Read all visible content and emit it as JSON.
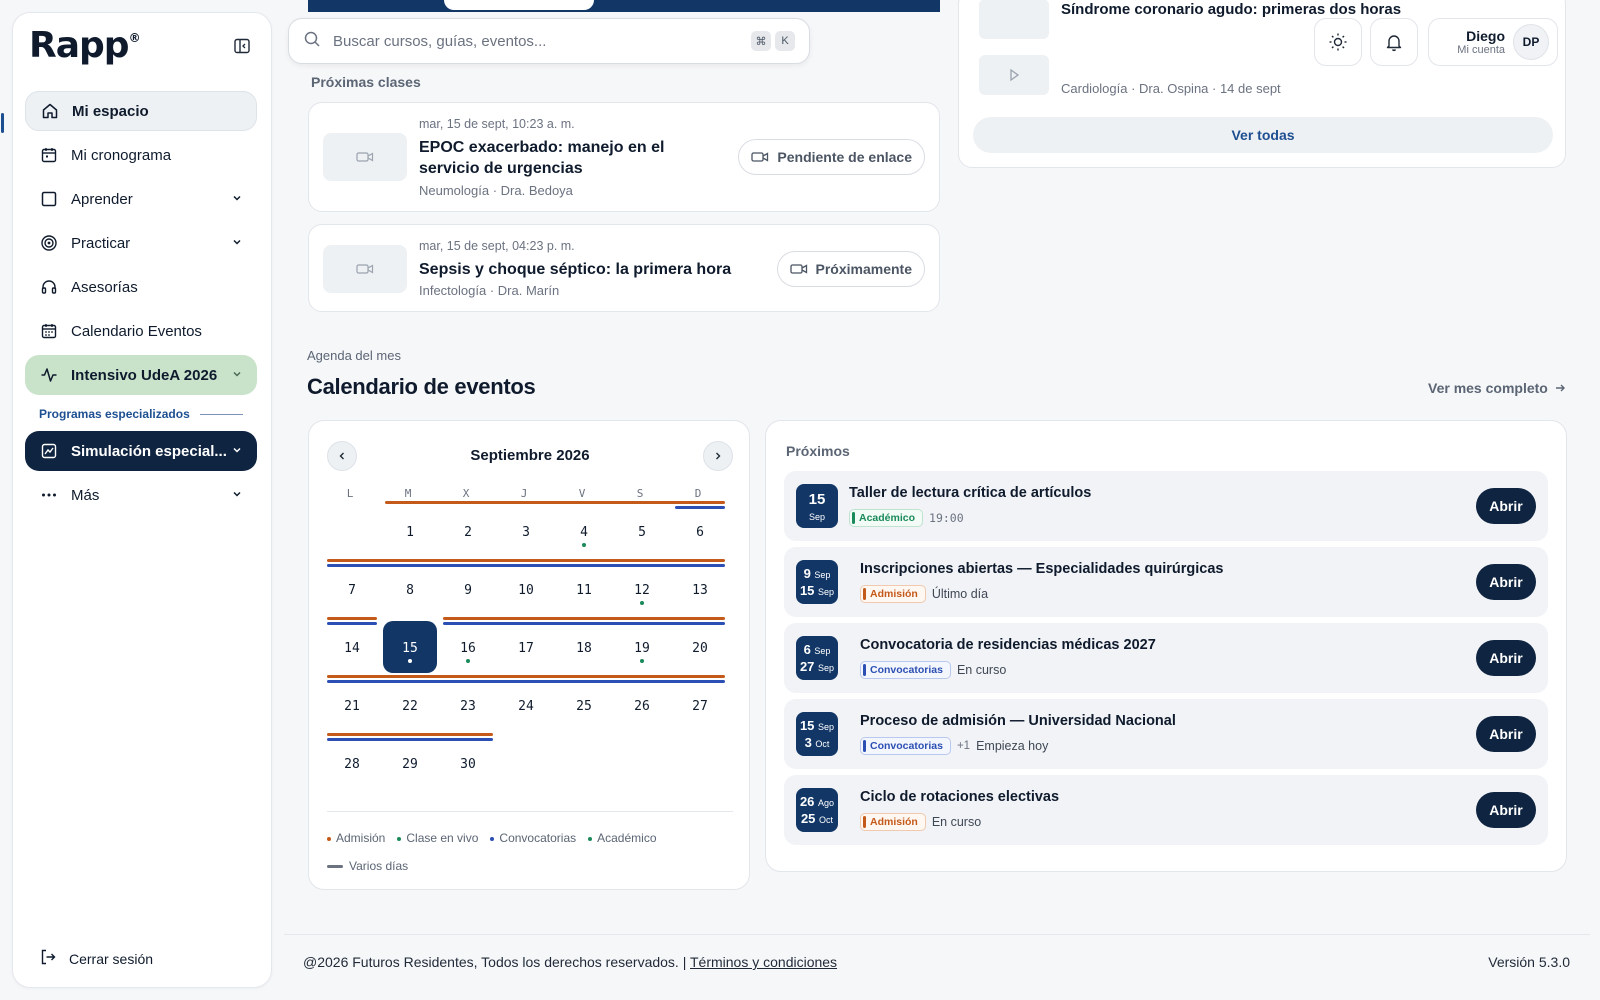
{
  "brand": {
    "logo": "Rapp",
    "mark": "®"
  },
  "sidebar": {
    "items": [
      {
        "label": "Mi espacio",
        "icon": "home-icon"
      },
      {
        "label": "Mi cronograma",
        "icon": "calendar-icon"
      },
      {
        "label": "Aprender",
        "icon": "square-icon"
      },
      {
        "label": "Practicar",
        "icon": "target-icon"
      },
      {
        "label": "Asesorías",
        "icon": "headset-icon"
      },
      {
        "label": "Calendario Eventos",
        "icon": "calendar-grid-icon"
      },
      {
        "label": "Intensivo UdeA 2026",
        "icon": "activity-icon"
      }
    ],
    "section_label": "Programas especializados",
    "special": {
      "label": "Simulación especial..."
    },
    "more": {
      "label": "Más"
    },
    "logout": "Cerrar sesión"
  },
  "topbar": {
    "search_placeholder": "Buscar cursos, guías, eventos...",
    "kbd_1": "⌘",
    "kbd_2": "K",
    "user_name": "Diego",
    "user_sub": "Mi cuenta",
    "avatar_initials": "DP"
  },
  "upcoming_classes": {
    "label": "Próximas clases",
    "items": [
      {
        "meta": "mar, 15 de sept, 10:23 a. m.",
        "title": "EPOC exacerbado: manejo en el servicio de urgencias",
        "sub": "Neumología · Dra. Bedoya",
        "status": "Pendiente de enlace"
      },
      {
        "meta": "mar, 15 de sept, 04:23 p. m.",
        "title": "Sepsis y choque séptico: la primera hora",
        "sub": "Infectología · Dra. Marín",
        "status": "Próximamente"
      }
    ]
  },
  "recordings": {
    "items": [
      {
        "title": "Síndrome coronario agudo: primeras dos horas",
        "sub": ""
      },
      {
        "title": "",
        "sub": "Cardiología · Dra. Ospina  ·  14 de sept"
      }
    ],
    "see_all": "Ver todas"
  },
  "agenda": {
    "label": "Agenda del mes",
    "title": "Calendario de eventos",
    "see_month": "Ver mes completo"
  },
  "calendar": {
    "month": "Septiembre 2026",
    "weekdays": [
      "L",
      "M",
      "X",
      "J",
      "V",
      "S",
      "D"
    ],
    "weeks": [
      [
        "",
        "1",
        "2",
        "3",
        "4",
        "5",
        "6"
      ],
      [
        "7",
        "8",
        "9",
        "10",
        "11",
        "12",
        "13"
      ],
      [
        "14",
        "15",
        "16",
        "17",
        "18",
        "19",
        "20"
      ],
      [
        "21",
        "22",
        "23",
        "24",
        "25",
        "26",
        "27"
      ],
      [
        "28",
        "29",
        "30",
        "",
        "",
        "",
        ""
      ]
    ],
    "today": "15",
    "dot_days": [
      "4",
      "12",
      "15",
      "16",
      "19"
    ],
    "legend": [
      {
        "label": "Admisión",
        "color": "#c45a1a"
      },
      {
        "label": "Clase en vivo",
        "color": "#1a8a5a"
      },
      {
        "label": "Convocatorias",
        "color": "#2c4fb3"
      },
      {
        "label": "Académico",
        "color": "#1a8a5a"
      }
    ],
    "legend_multi": "Varios días"
  },
  "events": {
    "label": "Próximos",
    "open_label": "Abrir",
    "items": [
      {
        "d1": "15",
        "m1": "Sep",
        "d2": "",
        "m2": "",
        "title": "Taller de lectura crítica de artículos",
        "tag": "Académico",
        "tag_color": "green",
        "extra": "",
        "note": "19:00"
      },
      {
        "d1": "9",
        "m1": "Sep",
        "d2": "15",
        "m2": "Sep",
        "title": "Inscripciones abiertas — Especialidades quirúrgicas",
        "tag": "Admisión",
        "tag_color": "orange",
        "extra": "",
        "note": "Último día"
      },
      {
        "d1": "6",
        "m1": "Sep",
        "d2": "27",
        "m2": "Sep",
        "title": "Convocatoria de residencias médicas 2027",
        "tag": "Convocatorias",
        "tag_color": "blue",
        "extra": "",
        "note": "En curso"
      },
      {
        "d1": "15",
        "m1": "Sep",
        "d2": "3",
        "m2": "Oct",
        "title": "Proceso de admisión — Universidad Nacional",
        "tag": "Convocatorias",
        "tag_color": "blue",
        "extra": "+1",
        "note": "Empieza hoy"
      },
      {
        "d1": "26",
        "m1": "Ago",
        "d2": "25",
        "m2": "Oct",
        "title": "Ciclo de rotaciones electivas",
        "tag": "Admisión",
        "tag_color": "orange",
        "extra": "",
        "note": "En curso"
      }
    ]
  },
  "footer": {
    "copyright": "@2026 Futuros Residentes, Todos los derechos reservados. | ",
    "terms": "Términos y condiciones",
    "version": "Versión 5.3.0"
  }
}
